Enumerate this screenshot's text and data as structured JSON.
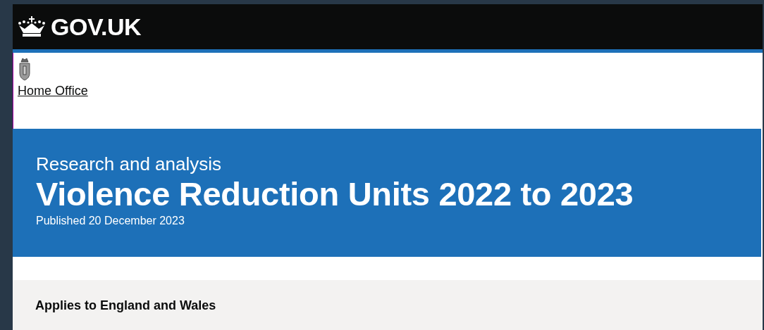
{
  "header": {
    "logo_text": "GOV.UK"
  },
  "organisation": {
    "name": "Home Office"
  },
  "banner": {
    "context": "Research and analysis",
    "title": "Violence Reduction Units 2022 to 2023",
    "published": "Published 20 December 2023"
  },
  "applies_to": {
    "text": "Applies to England and Wales"
  }
}
